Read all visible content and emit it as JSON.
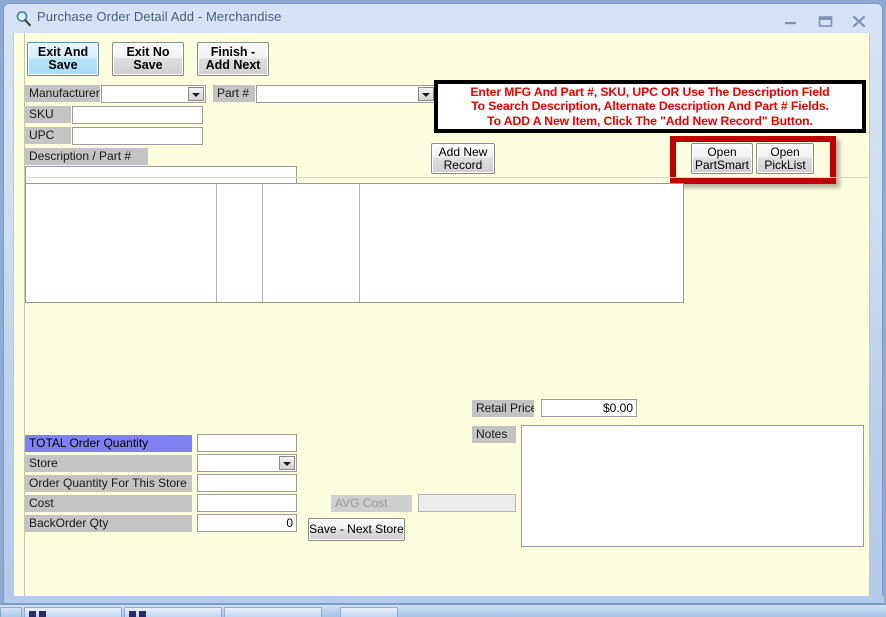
{
  "window": {
    "title": "Purchase Order Detail Add - Merchandise",
    "icon": "magnifier-icon",
    "controls": {
      "minimize": "minimize-icon",
      "maximize": "maximize-icon",
      "close": "close-icon"
    }
  },
  "toolbar": {
    "exit_and_save": "Exit And\nSave",
    "exit_no_save": "Exit No\nSave",
    "finish_add_next": "Finish -\nAdd Next"
  },
  "search": {
    "manufacturer_label": "Manufacturer",
    "manufacturer_value": "",
    "part_label": "Part #",
    "part_value": "",
    "sku_label": "SKU",
    "sku_value": "",
    "upc_label": "UPC",
    "upc_value": "",
    "description_label": "Description / Part #",
    "description_value": ""
  },
  "instruction": {
    "line1": "Enter MFG And Part #, SKU, UPC  OR Use The Description Field",
    "line2": "To Search Description, Alternate Description And Part # Fields.",
    "line3": "To ADD A New Item, Click The \"Add New Record\" Button.",
    "text_color": "#ee0000",
    "border_color": "#000000"
  },
  "actions": {
    "add_new_record": "Add New\nRecord",
    "open_partsmart": "Open\nPartSmart",
    "open_picklist": "Open\nPickList",
    "highlight_color": "#c00000"
  },
  "results_grid": {
    "rows": [],
    "column_count": 4
  },
  "order": {
    "total_order_quantity_label": "TOTAL Order Quantity",
    "total_order_quantity_value": "",
    "total_order_quantity_highlight": "#8080f0",
    "store_label": "Store",
    "store_value": "",
    "order_qty_store_label": "Order Quantity For This Store",
    "order_qty_store_value": "",
    "cost_label": "Cost",
    "cost_value": "",
    "backorder_label": "BackOrder Qty",
    "backorder_value": "0",
    "avg_cost_label": "AVG Cost",
    "avg_cost_value": "",
    "save_next_store": "Save - Next Store"
  },
  "pricing": {
    "retail_price_label": "Retail Price",
    "retail_price_value": "$0.00",
    "notes_label": "Notes",
    "notes_value": ""
  },
  "theme": {
    "form_background": "#fdfddf",
    "label_background": "#c3c3c3",
    "window_chrome": "#cddcf0"
  }
}
